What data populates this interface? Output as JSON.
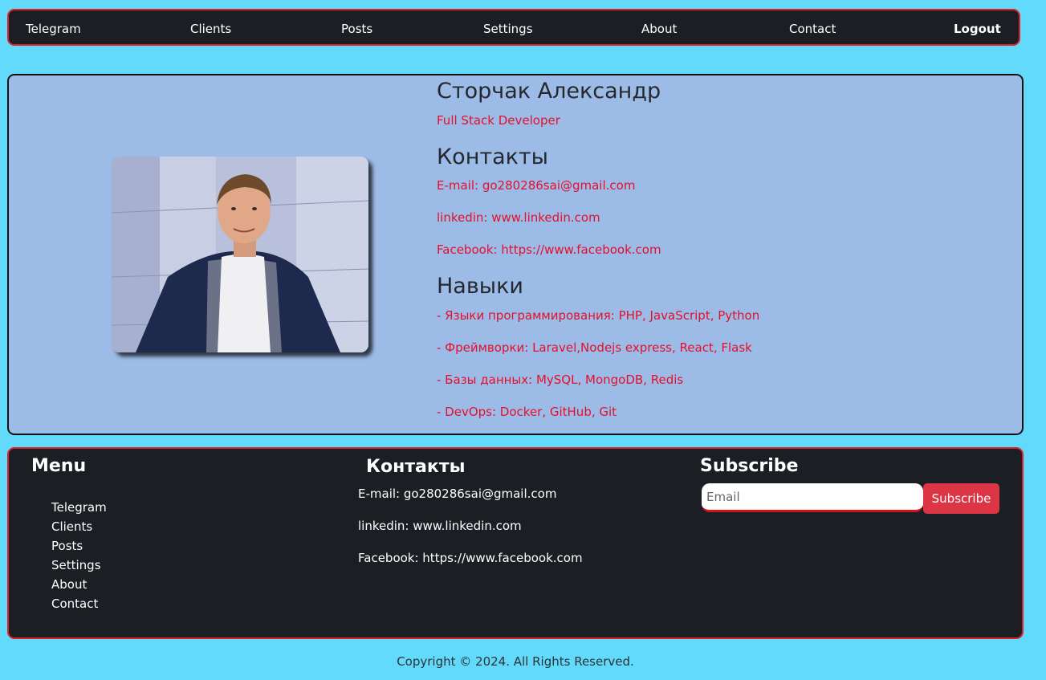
{
  "nav": {
    "items": [
      {
        "label": "Telegram"
      },
      {
        "label": "Clients"
      },
      {
        "label": "Posts"
      },
      {
        "label": "Settings"
      },
      {
        "label": "About"
      },
      {
        "label": "Contact"
      }
    ],
    "logout": "Logout"
  },
  "profile": {
    "name": "Сторчак Александр",
    "title": "Full Stack Developer",
    "contacts_heading": "Контакты",
    "contacts": [
      "E-mail: go280286sai@gmail.com",
      "linkedin: www.linkedin.com",
      "Facebook: https://www.facebook.com"
    ],
    "skills_heading": "Навыки",
    "skills": [
      "- Языки программирования: PHP, JavaScript, Python",
      "- Фреймворки: Laravel,Nodejs express, React, Flask",
      "- Базы данных: MySQL, MongoDB, Redis",
      "- DevOps: Docker, GitHub, Git"
    ]
  },
  "footer": {
    "menu_heading": "Menu",
    "menu": [
      "Telegram",
      "Clients",
      "Posts",
      "Settings",
      "About",
      "Contact"
    ],
    "contacts_heading": "Контакты",
    "contacts": [
      "E-mail: go280286sai@gmail.com",
      "linkedin: www.linkedin.com",
      "Facebook: https://www.facebook.com"
    ],
    "subscribe_heading": "Subscribe",
    "email_placeholder": "Email",
    "subscribe_button": "Subscribe"
  },
  "copyright": "Copyright © 2024. All Rights Reserved.",
  "colors": {
    "page_bg": "#61dafb",
    "dark_bg": "#1b1e22",
    "accent_red": "#e0202a",
    "profile_bg": "#9dbbe7",
    "link_red": "#e4102b",
    "button_red": "#dc3545"
  }
}
